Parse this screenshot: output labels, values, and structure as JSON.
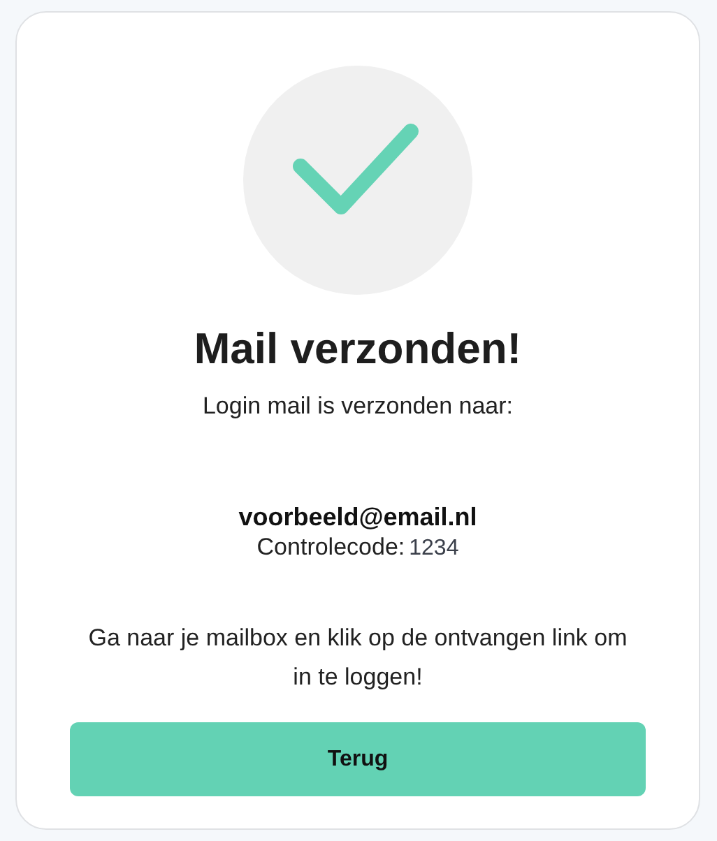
{
  "title": "Mail verzonden!",
  "subtitle": "Login mail is verzonden naar:",
  "email": "voorbeeld@email.nl",
  "code": {
    "label": "Controlecode:",
    "value": "1234"
  },
  "instruction": "Ga naar je mailbox en klik op de ontvangen link om in te loggen!",
  "button": "Terug"
}
